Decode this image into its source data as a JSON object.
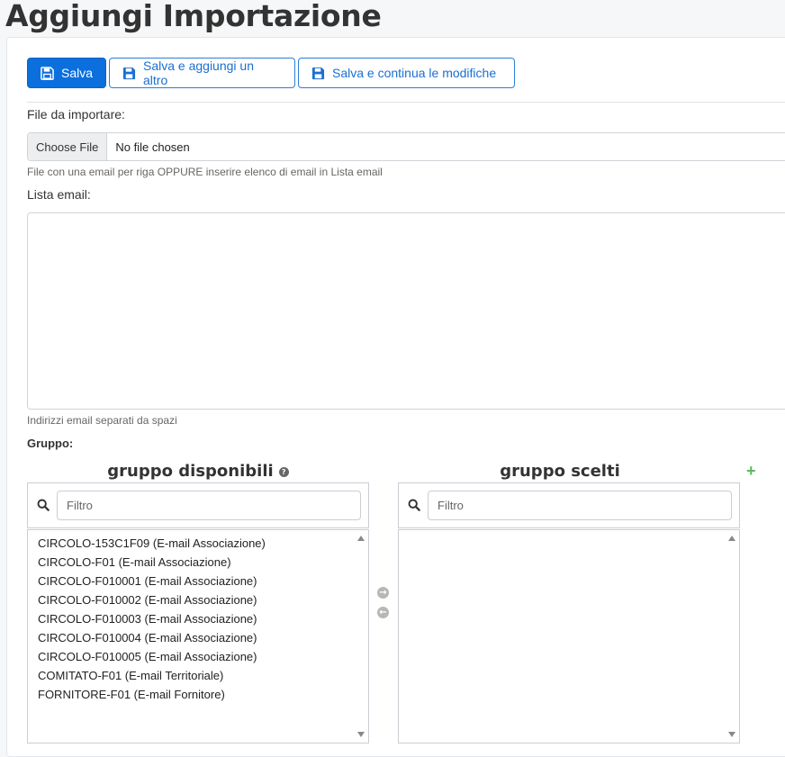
{
  "page": {
    "title": "Aggiungi Importazione"
  },
  "toolbar": {
    "save_label": "Salva",
    "save_add_label": "Salva e aggiungi un altro",
    "save_continue_label": "Salva e continua le modifiche"
  },
  "file_field": {
    "label": "File da importare:",
    "button_label": "Choose File",
    "status": "No file chosen",
    "help": "File con una email per riga OPPURE inserire elenco di email in Lista email"
  },
  "email_list": {
    "label": "Lista email:",
    "value": "",
    "help": "Indirizzi email separati da spazi"
  },
  "group": {
    "label": "Gruppo:",
    "available_title": "gruppo disponibili",
    "chosen_title": "gruppo scelti",
    "filter_placeholder": "Filtro",
    "available_items": [
      "CIRCOLO-153C1F09 (E-mail Associazione)",
      "CIRCOLO-F01 (E-mail Associazione)",
      "CIRCOLO-F010001 (E-mail Associazione)",
      "CIRCOLO-F010002 (E-mail Associazione)",
      "CIRCOLO-F010003 (E-mail Associazione)",
      "CIRCOLO-F010004 (E-mail Associazione)",
      "CIRCOLO-F010005 (E-mail Associazione)",
      "COMITATO-F01 (E-mail Territoriale)",
      "FORNITORE-F01 (E-mail Fornitore)"
    ],
    "chosen_items": []
  },
  "colors": {
    "primary": "#0b6fde",
    "add": "#5cb85c"
  },
  "icons": {
    "save": "floppy-disk-icon",
    "help": "question-circle-icon",
    "add": "plus-icon",
    "search": "search-icon",
    "move_right": "arrow-circle-right-icon",
    "move_left": "arrow-circle-left-icon"
  }
}
